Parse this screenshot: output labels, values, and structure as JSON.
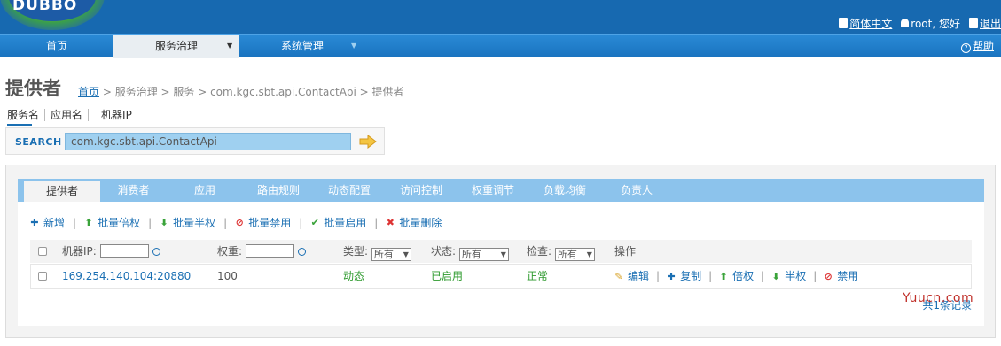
{
  "header": {
    "logo_text": "DUBBO",
    "language_label": "简体中文",
    "user_label": "root, 您好",
    "logout_label": "退出"
  },
  "nav": {
    "items": [
      {
        "label": "首页"
      },
      {
        "label": "服务治理",
        "caret": "▼"
      },
      {
        "label": "系统管理",
        "caret": "▼"
      }
    ],
    "help_label": "帮助"
  },
  "page": {
    "title": "提供者",
    "breadcrumb": {
      "home": "首页",
      "rest": "> 服务治理 > 服务 > com.kgc.sbt.api.ContactApi > 提供者"
    }
  },
  "search": {
    "tabs": [
      "服务名",
      "应用名",
      "机器IP"
    ],
    "label": "SEARCH",
    "value": "com.kgc.sbt.api.ContactApi"
  },
  "tabs": [
    "提供者",
    "消费者",
    "应用",
    "路由规则",
    "动态配置",
    "访问控制",
    "权重调节",
    "负载均衡",
    "负责人"
  ],
  "toolbar": {
    "add": "新增",
    "batch_double": "批量倍权",
    "batch_half": "批量半权",
    "batch_disable": "批量禁用",
    "batch_enable": "批量启用",
    "batch_delete": "批量删除"
  },
  "table": {
    "headers": {
      "ip": "机器IP:",
      "weight": "权重:",
      "type": "类型:",
      "status": "状态:",
      "check": "检查:",
      "ops": "操作"
    },
    "filters": {
      "type": "所有",
      "status": "所有",
      "check": "所有"
    },
    "rows": [
      {
        "address": "169.254.140.104:20880",
        "weight": "100",
        "type": "动态",
        "status": "已启用",
        "check": "正常",
        "actions": {
          "edit": "编辑",
          "copy": "复制",
          "double": "倍权",
          "half": "半权",
          "disable": "禁用"
        }
      }
    ],
    "footer": "共1条记录"
  },
  "watermark": "Yuucn.com",
  "colors": {
    "header": "#1769b0",
    "nav": "#1a74c0",
    "tabbar": "#8cc3ec",
    "link": "#1a6fb3",
    "ok": "#2e9a2e"
  }
}
